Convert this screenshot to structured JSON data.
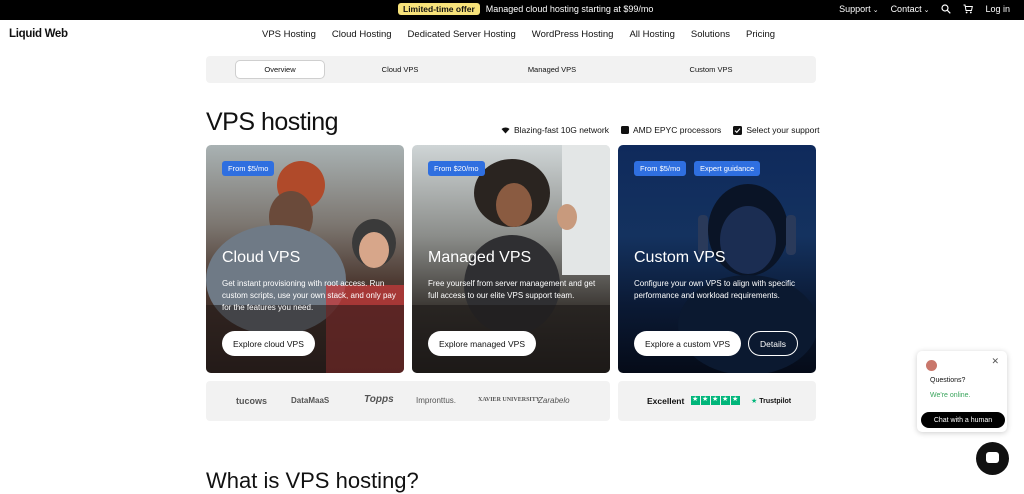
{
  "topbar": {
    "badge": "Limited-time offer",
    "promo_text": "Managed cloud hosting starting at $99/mo",
    "support": "Support",
    "contact": "Contact",
    "login": "Log in",
    "icons": [
      "search-icon",
      "cart-icon"
    ]
  },
  "nav": {
    "logo": "Liquid Web",
    "links": [
      "VPS Hosting",
      "Cloud Hosting",
      "Dedicated Server Hosting",
      "WordPress Hosting",
      "All Hosting",
      "Solutions",
      "Pricing"
    ]
  },
  "subtabs": [
    "Overview",
    "Cloud VPS",
    "Managed VPS",
    "Custom VPS"
  ],
  "heading": "VPS hosting",
  "features": [
    "Blazing-fast 10G network",
    "AMD EPYC processors",
    "Select your support"
  ],
  "cards": [
    {
      "pills": [
        "From $5/mo"
      ],
      "title": "Cloud VPS",
      "desc": "Get instant provisioning with root access. Run custom scripts, use your own stack, and only pay for the features you need.",
      "button": "Explore cloud VPS"
    },
    {
      "pills": [
        "From $20/mo"
      ],
      "title": "Managed VPS",
      "desc": "Free yourself from server management and get full access to our elite VPS support team.",
      "button": "Explore managed VPS"
    },
    {
      "pills": [
        "From $5/mo",
        "Expert guidance"
      ],
      "title": "Custom VPS",
      "desc": "Configure your own VPS to align with specific performance and workload requirements.",
      "button": "Explore a custom VPS",
      "button2": "Details"
    }
  ],
  "partner_logos": [
    "tucows",
    "DataMaaS",
    "Topps",
    "Impronttus.",
    "XAVIER UNIVERSITY",
    "Zarabelo"
  ],
  "trust": {
    "rating": "Excellent",
    "brand": "Trustpilot",
    "stars": 5
  },
  "section2_heading": "What is VPS hosting?",
  "chat": {
    "question": "Questions?",
    "status": "We're online.",
    "button": "Chat with a human"
  },
  "colors": {
    "accent": "#2f6fe0",
    "trustpilot": "#00b67a",
    "badge": "#f7e27a"
  }
}
